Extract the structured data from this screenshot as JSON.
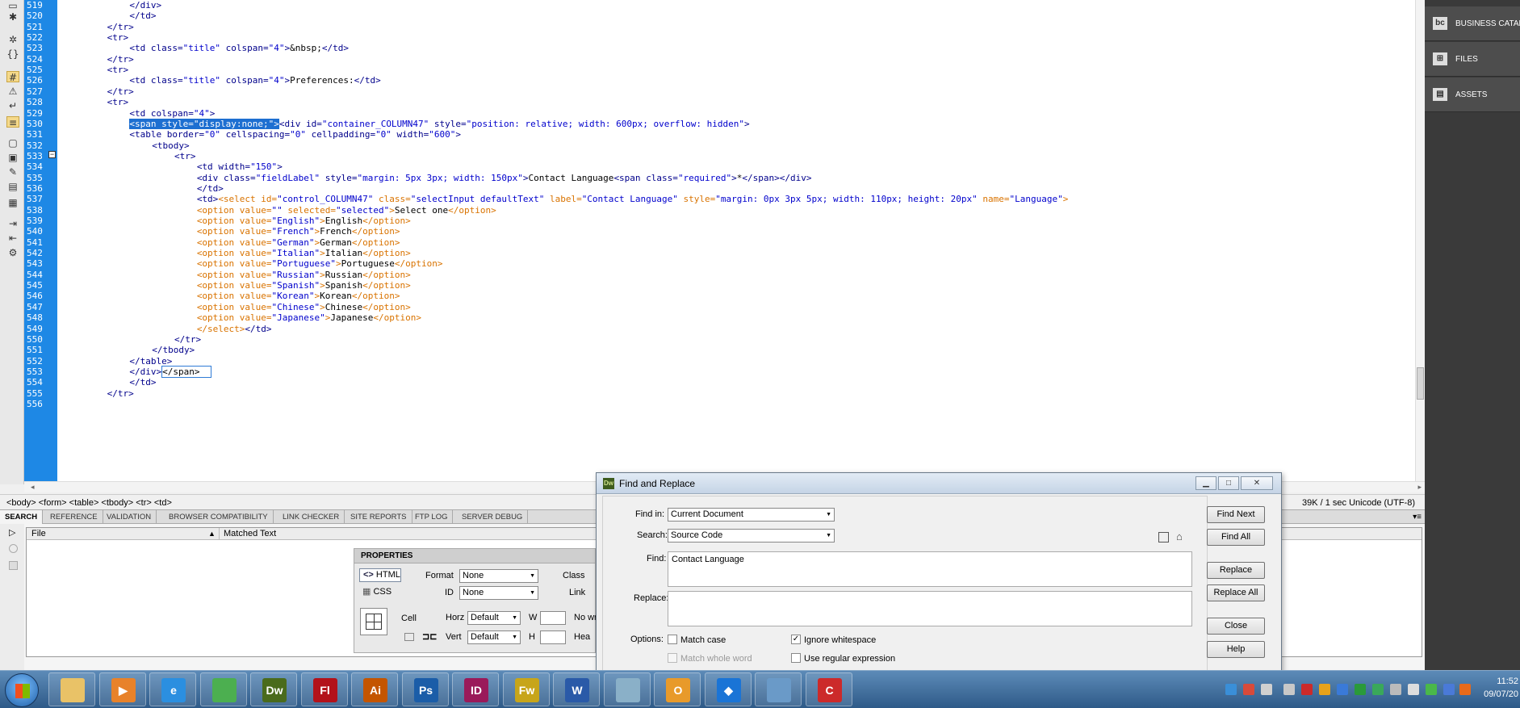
{
  "editor": {
    "lines": [
      {
        "n": "519",
        "indent": 12,
        "segs": [
          {
            "c": "t",
            "s": "</div>"
          }
        ]
      },
      {
        "n": "520",
        "indent": 12,
        "segs": [
          {
            "c": "t",
            "s": "</td>"
          }
        ]
      },
      {
        "n": "521",
        "indent": 8,
        "segs": [
          {
            "c": "t",
            "s": "</tr>"
          }
        ]
      },
      {
        "n": "522",
        "indent": 8,
        "segs": [
          {
            "c": "t",
            "s": "<tr>"
          }
        ]
      },
      {
        "n": "523",
        "indent": 12,
        "segs": [
          {
            "c": "t",
            "s": "<td "
          },
          {
            "c": "a",
            "s": "class="
          },
          {
            "c": "v",
            "s": "\"title\""
          },
          {
            "c": "a",
            "s": " colspan="
          },
          {
            "c": "v",
            "s": "\"4\""
          },
          {
            "c": "t",
            "s": ">"
          },
          {
            "c": "tx",
            "s": "&nbsp;"
          },
          {
            "c": "t",
            "s": "</td>"
          }
        ]
      },
      {
        "n": "524",
        "indent": 8,
        "segs": [
          {
            "c": "t",
            "s": "</tr>"
          }
        ]
      },
      {
        "n": "525",
        "indent": 8,
        "segs": [
          {
            "c": "t",
            "s": "<tr>"
          }
        ]
      },
      {
        "n": "526",
        "indent": 12,
        "segs": [
          {
            "c": "t",
            "s": "<td "
          },
          {
            "c": "a",
            "s": "class="
          },
          {
            "c": "v",
            "s": "\"title\""
          },
          {
            "c": "a",
            "s": " colspan="
          },
          {
            "c": "v",
            "s": "\"4\""
          },
          {
            "c": "t",
            "s": ">"
          },
          {
            "c": "tx",
            "s": "Preferences:"
          },
          {
            "c": "t",
            "s": "</td>"
          }
        ]
      },
      {
        "n": "527",
        "indent": 8,
        "segs": [
          {
            "c": "t",
            "s": "</tr>"
          }
        ]
      },
      {
        "n": "528",
        "indent": 8,
        "segs": [
          {
            "c": "t",
            "s": "<tr>"
          }
        ]
      },
      {
        "n": "529",
        "indent": 12,
        "segs": [
          {
            "c": "t",
            "s": "<td "
          },
          {
            "c": "a",
            "s": "colspan="
          },
          {
            "c": "v",
            "s": "\"4\""
          },
          {
            "c": "t",
            "s": ">"
          }
        ]
      },
      {
        "n": "530",
        "indent": 12,
        "segs": [
          {
            "c": "hl",
            "s": "<span style=\"display:none;\">"
          },
          {
            "c": "t",
            "s": "<div "
          },
          {
            "c": "a",
            "s": "id="
          },
          {
            "c": "v",
            "s": "\"container_COLUMN47\""
          },
          {
            "c": "a",
            "s": " style="
          },
          {
            "c": "v",
            "s": "\"position: relative; width: 600px; overflow: hidden\""
          },
          {
            "c": "t",
            "s": ">"
          }
        ]
      },
      {
        "n": "531",
        "indent": 12,
        "segs": [
          {
            "c": "t",
            "s": "<table "
          },
          {
            "c": "a",
            "s": "border="
          },
          {
            "c": "v",
            "s": "\"0\""
          },
          {
            "c": "a",
            "s": " cellspacing="
          },
          {
            "c": "v",
            "s": "\"0\""
          },
          {
            "c": "a",
            "s": " cellpadding="
          },
          {
            "c": "v",
            "s": "\"0\""
          },
          {
            "c": "a",
            "s": " width="
          },
          {
            "c": "v",
            "s": "\"600\""
          },
          {
            "c": "t",
            "s": ">"
          }
        ]
      },
      {
        "n": "532",
        "indent": 16,
        "segs": [
          {
            "c": "t",
            "s": "<tbody>"
          }
        ]
      },
      {
        "n": "533",
        "indent": 20,
        "segs": [
          {
            "c": "t",
            "s": "<tr>"
          }
        ]
      },
      {
        "n": "534",
        "indent": 24,
        "segs": [
          {
            "c": "t",
            "s": "<td "
          },
          {
            "c": "a",
            "s": "width="
          },
          {
            "c": "v",
            "s": "\"150\""
          },
          {
            "c": "t",
            "s": ">"
          }
        ]
      },
      {
        "n": "535",
        "indent": 24,
        "segs": [
          {
            "c": "t",
            "s": "<div "
          },
          {
            "c": "a",
            "s": "class="
          },
          {
            "c": "v",
            "s": "\"fieldLabel\""
          },
          {
            "c": "a",
            "s": " style="
          },
          {
            "c": "v",
            "s": "\"margin: 5px 3px; width: 150px\""
          },
          {
            "c": "t",
            "s": ">"
          },
          {
            "c": "tx",
            "s": "Contact Language"
          },
          {
            "c": "t",
            "s": "<span "
          },
          {
            "c": "a",
            "s": "class="
          },
          {
            "c": "v",
            "s": "\"required\""
          },
          {
            "c": "t",
            "s": ">"
          },
          {
            "c": "tx",
            "s": "*"
          },
          {
            "c": "t",
            "s": "</span></div>"
          }
        ]
      },
      {
        "n": "536",
        "indent": 24,
        "segs": [
          {
            "c": "t",
            "s": "</td>"
          }
        ]
      },
      {
        "n": "537",
        "indent": 24,
        "segs": [
          {
            "c": "t",
            "s": "<td>"
          },
          {
            "c": "g",
            "s": "<select "
          },
          {
            "c": "g",
            "s": "id="
          },
          {
            "c": "v",
            "s": "\"control_COLUMN47\""
          },
          {
            "c": "g",
            "s": " class="
          },
          {
            "c": "v",
            "s": "\"selectInput defaultText\""
          },
          {
            "c": "g",
            "s": " label="
          },
          {
            "c": "v",
            "s": "\"Contact Language\""
          },
          {
            "c": "g",
            "s": " style="
          },
          {
            "c": "v",
            "s": "\"margin: 0px 3px 5px; width: 110px; height: 20px\""
          },
          {
            "c": "g",
            "s": " name="
          },
          {
            "c": "v",
            "s": "\"Language\""
          },
          {
            "c": "g",
            "s": ">"
          }
        ]
      },
      {
        "n": "538",
        "indent": 24,
        "segs": [
          {
            "c": "g",
            "s": "<option "
          },
          {
            "c": "g",
            "s": "value="
          },
          {
            "c": "v",
            "s": "\"\""
          },
          {
            "c": "g",
            "s": " selected="
          },
          {
            "c": "v",
            "s": "\"selected\""
          },
          {
            "c": "g",
            "s": ">"
          },
          {
            "c": "tx",
            "s": "Select one"
          },
          {
            "c": "g",
            "s": "</option>"
          }
        ]
      },
      {
        "n": "539",
        "indent": 24,
        "segs": [
          {
            "c": "g",
            "s": "<option "
          },
          {
            "c": "g",
            "s": "value="
          },
          {
            "c": "v",
            "s": "\"English\""
          },
          {
            "c": "g",
            "s": ">"
          },
          {
            "c": "tx",
            "s": "English"
          },
          {
            "c": "g",
            "s": "</option>"
          }
        ]
      },
      {
        "n": "540",
        "indent": 24,
        "segs": [
          {
            "c": "g",
            "s": "<option "
          },
          {
            "c": "g",
            "s": "value="
          },
          {
            "c": "v",
            "s": "\"French\""
          },
          {
            "c": "g",
            "s": ">"
          },
          {
            "c": "tx",
            "s": "French"
          },
          {
            "c": "g",
            "s": "</option>"
          }
        ]
      },
      {
        "n": "541",
        "indent": 24,
        "segs": [
          {
            "c": "g",
            "s": "<option "
          },
          {
            "c": "g",
            "s": "value="
          },
          {
            "c": "v",
            "s": "\"German\""
          },
          {
            "c": "g",
            "s": ">"
          },
          {
            "c": "tx",
            "s": "German"
          },
          {
            "c": "g",
            "s": "</option>"
          }
        ]
      },
      {
        "n": "542",
        "indent": 24,
        "segs": [
          {
            "c": "g",
            "s": "<option "
          },
          {
            "c": "g",
            "s": "value="
          },
          {
            "c": "v",
            "s": "\"Italian\""
          },
          {
            "c": "g",
            "s": ">"
          },
          {
            "c": "tx",
            "s": "Italian"
          },
          {
            "c": "g",
            "s": "</option>"
          }
        ]
      },
      {
        "n": "543",
        "indent": 24,
        "segs": [
          {
            "c": "g",
            "s": "<option "
          },
          {
            "c": "g",
            "s": "value="
          },
          {
            "c": "v",
            "s": "\"Portuguese\""
          },
          {
            "c": "g",
            "s": ">"
          },
          {
            "c": "tx",
            "s": "Portuguese"
          },
          {
            "c": "g",
            "s": "</option>"
          }
        ]
      },
      {
        "n": "544",
        "indent": 24,
        "segs": [
          {
            "c": "g",
            "s": "<option "
          },
          {
            "c": "g",
            "s": "value="
          },
          {
            "c": "v",
            "s": "\"Russian\""
          },
          {
            "c": "g",
            "s": ">"
          },
          {
            "c": "tx",
            "s": "Russian"
          },
          {
            "c": "g",
            "s": "</option>"
          }
        ]
      },
      {
        "n": "545",
        "indent": 24,
        "segs": [
          {
            "c": "g",
            "s": "<option "
          },
          {
            "c": "g",
            "s": "value="
          },
          {
            "c": "v",
            "s": "\"Spanish\""
          },
          {
            "c": "g",
            "s": ">"
          },
          {
            "c": "tx",
            "s": "Spanish"
          },
          {
            "c": "g",
            "s": "</option>"
          }
        ]
      },
      {
        "n": "546",
        "indent": 24,
        "segs": [
          {
            "c": "g",
            "s": "<option "
          },
          {
            "c": "g",
            "s": "value="
          },
          {
            "c": "v",
            "s": "\"Korean\""
          },
          {
            "c": "g",
            "s": ">"
          },
          {
            "c": "tx",
            "s": "Korean"
          },
          {
            "c": "g",
            "s": "</option>"
          }
        ]
      },
      {
        "n": "547",
        "indent": 24,
        "segs": [
          {
            "c": "g",
            "s": "<option "
          },
          {
            "c": "g",
            "s": "value="
          },
          {
            "c": "v",
            "s": "\"Chinese\""
          },
          {
            "c": "g",
            "s": ">"
          },
          {
            "c": "tx",
            "s": "Chinese"
          },
          {
            "c": "g",
            "s": "</option>"
          }
        ]
      },
      {
        "n": "548",
        "indent": 24,
        "segs": [
          {
            "c": "g",
            "s": "<option "
          },
          {
            "c": "g",
            "s": "value="
          },
          {
            "c": "v",
            "s": "\"Japanese\""
          },
          {
            "c": "g",
            "s": ">"
          },
          {
            "c": "tx",
            "s": "Japanese"
          },
          {
            "c": "g",
            "s": "</option>"
          }
        ]
      },
      {
        "n": "549",
        "indent": 24,
        "segs": [
          {
            "c": "g",
            "s": "</select>"
          },
          {
            "c": "t",
            "s": "</td>"
          }
        ]
      },
      {
        "n": "550",
        "indent": 20,
        "segs": [
          {
            "c": "t",
            "s": "</tr>"
          }
        ]
      },
      {
        "n": "551",
        "indent": 16,
        "segs": [
          {
            "c": "t",
            "s": "</tbody>"
          }
        ]
      },
      {
        "n": "552",
        "indent": 12,
        "segs": [
          {
            "c": "t",
            "s": "</table>"
          }
        ]
      },
      {
        "n": "553",
        "indent": 12,
        "segs": [
          {
            "c": "t",
            "s": "</div>"
          },
          {
            "c": "bx",
            "s": "</span>  "
          }
        ]
      },
      {
        "n": "554",
        "indent": 12,
        "segs": [
          {
            "c": "t",
            "s": "</td>"
          }
        ]
      },
      {
        "n": "555",
        "indent": 8,
        "segs": [
          {
            "c": "t",
            "s": "</tr>"
          }
        ]
      },
      {
        "n": "556",
        "indent": 8,
        "segs": []
      }
    ]
  },
  "right_panel": {
    "items": [
      {
        "label": "BUSINESS CATAL",
        "icon": "bc-icon",
        "glyph": "bc"
      },
      {
        "label": "FILES",
        "icon": "files-tree-icon",
        "glyph": "⊞"
      },
      {
        "label": "ASSETS",
        "icon": "assets-icon",
        "glyph": "▤"
      }
    ]
  },
  "status_bar": {
    "tag_path": "<body> <form> <table> <tbody> <tr> <td>",
    "size_info": "39K / 1 sec  Unicode (UTF-8)"
  },
  "panel_tabs": [
    "SEARCH",
    "REFERENCE",
    "VALIDATION",
    "BROWSER COMPATIBILITY",
    "LINK CHECKER",
    "SITE REPORTS",
    "FTP LOG",
    "SERVER DEBUG"
  ],
  "search_panel": {
    "col_file": "File",
    "col_matched": "Matched Text"
  },
  "properties": {
    "title": "PROPERTIES",
    "html_btn": "HTML",
    "css_btn": "CSS",
    "format_label": "Format",
    "format_value": "None",
    "id_label": "ID",
    "id_value": "None",
    "class_label": "Class",
    "link_label": "Link",
    "cell_label": "Cell",
    "horz_label": "Horz",
    "horz_value": "Default",
    "vert_label": "Vert",
    "vert_value": "Default",
    "w_label": "W",
    "h_label": "H",
    "no_wrap": "No wr",
    "header": "Hea"
  },
  "find_replace": {
    "title": "Find and Replace",
    "find_in_label": "Find in:",
    "find_in_value": "Current Document",
    "search_label": "Search:",
    "search_value": "Source Code",
    "find_label": "Find:",
    "find_value": "Contact Language",
    "replace_label": "Replace:",
    "replace_value": "",
    "options_label": "Options:",
    "match_case": "Match case",
    "match_whole": "Match whole word",
    "ignore_ws": "Ignore whitespace",
    "regex": "Use regular expression",
    "ignore_ws_checked": true,
    "buttons": {
      "find_next": "Find Next",
      "find_all": "Find All",
      "replace": "Replace",
      "replace_all": "Replace All",
      "close": "Close",
      "help": "Help"
    }
  },
  "taskbar": {
    "apps": [
      {
        "name": "explorer",
        "glyph": "",
        "color": "#e9c267"
      },
      {
        "name": "media-player",
        "glyph": "▶",
        "color": "#e8822a"
      },
      {
        "name": "internet-explorer",
        "glyph": "e",
        "color": "#2b8fe0"
      },
      {
        "name": "chrome",
        "glyph": "",
        "color": "#4caf50"
      },
      {
        "name": "dreamweaver",
        "glyph": "Dw",
        "color": "#4a6b1c"
      },
      {
        "name": "flash",
        "glyph": "Fl",
        "color": "#b3121a"
      },
      {
        "name": "illustrator",
        "glyph": "Ai",
        "color": "#c45500"
      },
      {
        "name": "photoshop",
        "glyph": "Ps",
        "color": "#1b5da8"
      },
      {
        "name": "indesign",
        "glyph": "ID",
        "color": "#9a1a5a"
      },
      {
        "name": "fireworks",
        "glyph": "Fw",
        "color": "#c7a51a"
      },
      {
        "name": "word",
        "glyph": "W",
        "color": "#2a5aa8"
      },
      {
        "name": "files-app",
        "glyph": "",
        "color": "#8ab0c8"
      },
      {
        "name": "outlook",
        "glyph": "O",
        "color": "#e89a2a"
      },
      {
        "name": "dropbox",
        "glyph": "◆",
        "color": "#1a74d6"
      },
      {
        "name": "network-app",
        "glyph": "",
        "color": "#6a9ac8"
      },
      {
        "name": "ccleaner",
        "glyph": "C",
        "color": "#cc2a2a"
      }
    ],
    "time": "11:52",
    "date": "09/07/20"
  }
}
